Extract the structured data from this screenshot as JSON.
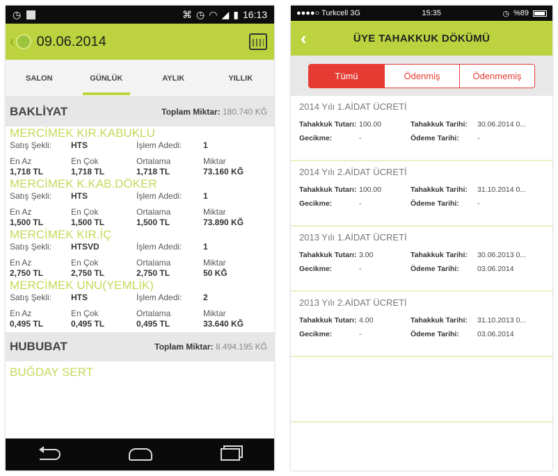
{
  "android": {
    "status": {
      "time": "16:13"
    },
    "appbar": {
      "back": "‹",
      "date": "09.06.2014"
    },
    "tabs": [
      "SALON",
      "GÜNLÜK",
      "AYLIK",
      "YILLIK"
    ],
    "sections": [
      {
        "name": "BAKLİYAT",
        "total_label": "Toplam Miktar:",
        "total_value": "180.740 KĞ",
        "items": [
          {
            "title": "MERCİMEK KIR.KABUKLU",
            "satis_label": "Satış Şekli:",
            "satis": "HTS",
            "islem_label": "İşlem Adedi:",
            "islem": "1",
            "h_min": "En Az",
            "h_max": "En Çok",
            "h_avg": "Ortalama",
            "h_qty": "Miktar",
            "min": "1,718 TL",
            "max": "1,718 TL",
            "avg": "1,718 TL",
            "qty": "73.160 KĞ"
          },
          {
            "title": "MERCİMEK K.KAB.DÖKER",
            "satis_label": "Satış Şekli:",
            "satis": "HTS",
            "islem_label": "İşlem Adedi:",
            "islem": "1",
            "h_min": "En Az",
            "h_max": "En Çok",
            "h_avg": "Ortalama",
            "h_qty": "Miktar",
            "min": "1,500 TL",
            "max": "1,500 TL",
            "avg": "1,500 TL",
            "qty": "73.890 KĞ"
          },
          {
            "title": "MERCİMEK KIR.İÇ",
            "satis_label": "Satış Şekli:",
            "satis": "HTSVD",
            "islem_label": "İşlem Adedi:",
            "islem": "1",
            "h_min": "En Az",
            "h_max": "En Çok",
            "h_avg": "Ortalama",
            "h_qty": "Miktar",
            "min": "2,750 TL",
            "max": "2,750 TL",
            "avg": "2,750 TL",
            "qty": "50 KĞ"
          },
          {
            "title": "MERCİMEK UNU(YEMLİK)",
            "satis_label": "Satış Şekli:",
            "satis": "HTS",
            "islem_label": "İşlem Adedi:",
            "islem": "2",
            "h_min": "En Az",
            "h_max": "En Çok",
            "h_avg": "Ortalama",
            "h_qty": "Miktar",
            "min": "0,495 TL",
            "max": "0,495 TL",
            "avg": "0,495 TL",
            "qty": "33.640 KĞ"
          }
        ]
      },
      {
        "name": "HUBUBAT",
        "total_label": "Toplam Miktar:",
        "total_value": "8.494.195 KĞ",
        "items": [
          {
            "title": "BUĞDAY SERT"
          }
        ]
      }
    ]
  },
  "ios": {
    "status": {
      "carrier": "●●●●○ Turkcell  3G",
      "time": "15:35",
      "battery": "%89"
    },
    "nav": {
      "back": "‹",
      "title": "ÜYE TAHAKKUK DÖKÜMÜ"
    },
    "segments": [
      "Tümü",
      "Ödenmiş",
      "Ödenmemiş"
    ],
    "cards": [
      {
        "title": "2014 Yılı 1.AİDAT ÜCRETİ",
        "k_tutar": "Tahakkuk Tutarı:",
        "tutar": "100.00",
        "k_tarih": "Tahakkuk Tarihi:",
        "tarih": "30.06.2014 0...",
        "k_gecikme": "Gecikme:",
        "gecikme": "-",
        "k_odeme": "Ödeme Tarihi:",
        "odeme": "-"
      },
      {
        "title": "2014 Yılı 2.AİDAT ÜCRETİ",
        "k_tutar": "Tahakkuk Tutarı:",
        "tutar": "100.00",
        "k_tarih": "Tahakkuk Tarihi:",
        "tarih": "31.10.2014 0...",
        "k_gecikme": "Gecikme:",
        "gecikme": "-",
        "k_odeme": "Ödeme Tarihi:",
        "odeme": "-"
      },
      {
        "title": "2013 Yılı 1.AİDAT ÜCRETİ",
        "k_tutar": "Tahakkuk Tutarı:",
        "tutar": "3.00",
        "k_tarih": "Tahakkuk Tarihi:",
        "tarih": "30.06.2013 0...",
        "k_gecikme": "Gecikme:",
        "gecikme": "-",
        "k_odeme": "Ödeme Tarihi:",
        "odeme": "03.06.2014"
      },
      {
        "title": "2013 Yılı 2.AİDAT ÜCRETİ",
        "k_tutar": "Tahakkuk Tutarı:",
        "tutar": "4.00",
        "k_tarih": "Tahakkuk Tarihi:",
        "tarih": "31.10.2013 0...",
        "k_gecikme": "Gecikme:",
        "gecikme": "-",
        "k_odeme": "Ödeme Tarihi:",
        "odeme": "03.06.2014"
      }
    ]
  },
  "colors": {
    "accent_green": "#bcd33f",
    "item_title_green": "#c6d85a",
    "segment_red": "#e53b32"
  }
}
